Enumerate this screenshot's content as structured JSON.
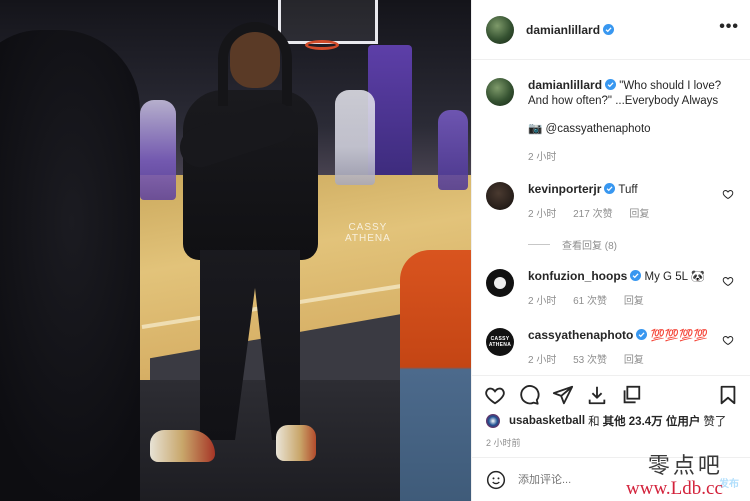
{
  "photo": {
    "watermark_line1": "CASSY",
    "watermark_line2": "ATHENA"
  },
  "header": {
    "username": "damianlillard",
    "more": "•••"
  },
  "caption": {
    "username": "damianlillard",
    "text": "\"Who should I love? And how often?\" ...Everybody Always",
    "credit_icon": "camera-emoji",
    "credit": "📷 @cassyathenaphoto",
    "time": "2 小时"
  },
  "comments": [
    {
      "username": "kevinporterjr",
      "verified": true,
      "text": "Tuff",
      "time": "2 小时",
      "likes": "217 次赞",
      "reply": "回复"
    },
    {
      "username": "konfuzion_hoops",
      "verified": true,
      "text": "My G 5L 🐼",
      "time": "2 小时",
      "likes": "61 次赞",
      "reply": "回复"
    },
    {
      "username": "cassyathenaphoto",
      "verified": true,
      "text": "💯💯💯💯",
      "time": "2 小时",
      "likes": "53 次赞",
      "reply": "回复"
    }
  ],
  "view_replies": "查看回复 (8)",
  "avatar_text": {
    "cassy": "CASSY ATHENA"
  },
  "likes_line": {
    "user": "usabasketball",
    "and": "和",
    "others": "其他 23.4万 位用户",
    "liked": "赞了"
  },
  "time_ago": "2 小时前",
  "add_comment": {
    "placeholder": "添加评论...",
    "post": "发布"
  },
  "site_watermark": {
    "cn": "零点吧",
    "url": "www.Ldb.cc"
  },
  "colors": {
    "verified": "#3897f0",
    "text": "#262626",
    "muted": "#8e8e8e",
    "watermark_red": "#d3223b"
  }
}
